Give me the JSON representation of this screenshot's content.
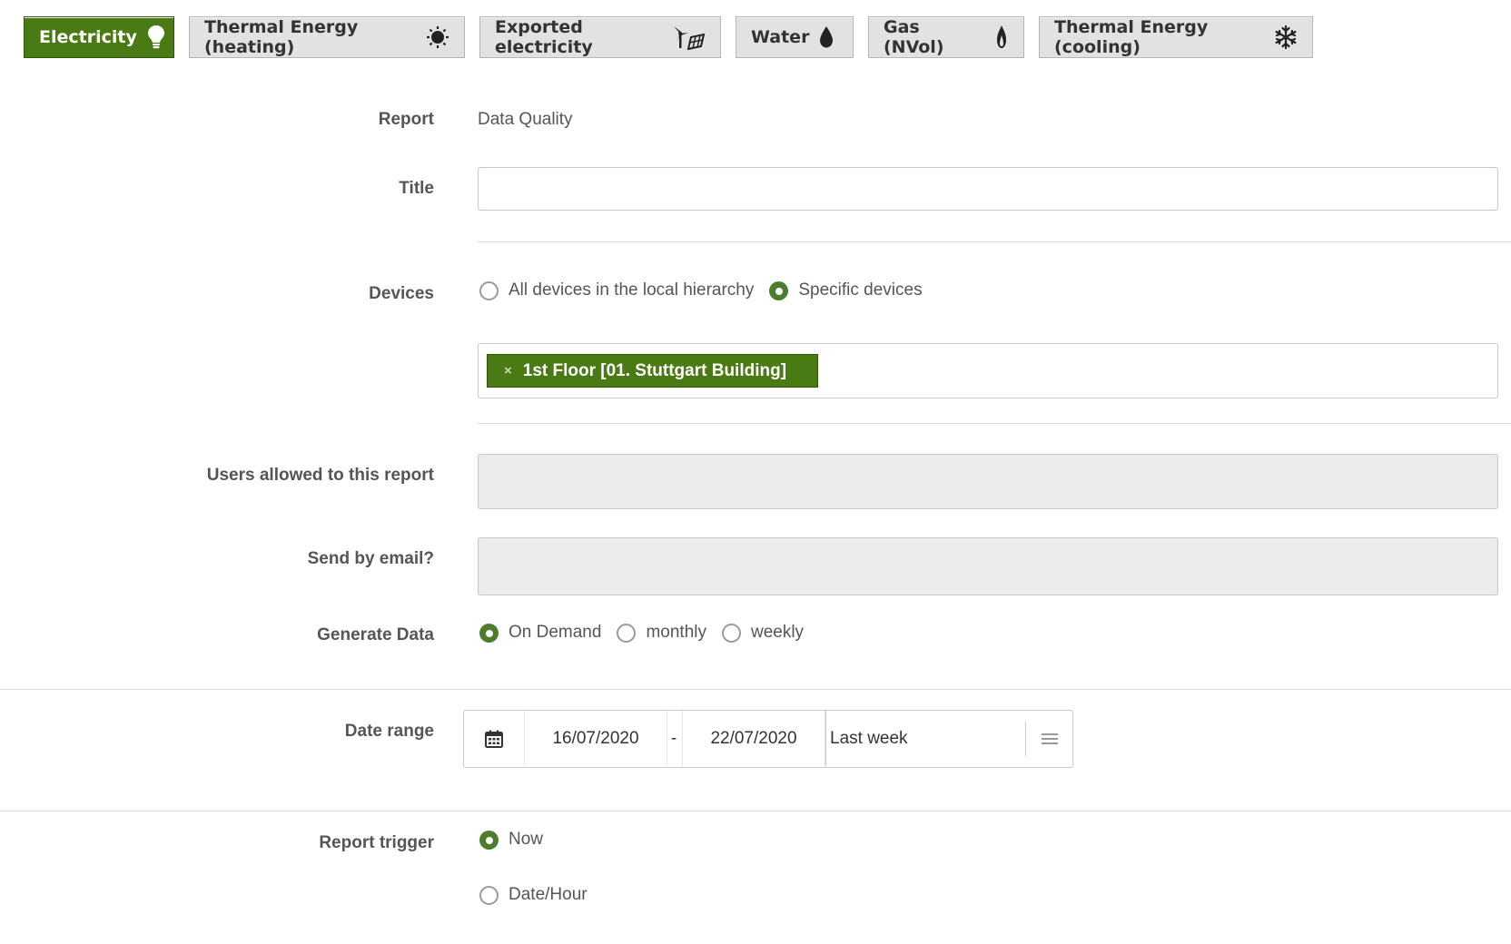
{
  "tabs": [
    {
      "label": "Electricity",
      "icon": "lightbulb-icon",
      "active": true
    },
    {
      "label": "Thermal Energy (heating)",
      "icon": "sun-icon",
      "active": false
    },
    {
      "label": "Exported electricity",
      "icon": "wind-solar-icon",
      "active": false
    },
    {
      "label": "Water",
      "icon": "water-drop-icon",
      "active": false
    },
    {
      "label": "Gas (NVol)",
      "icon": "flame-icon",
      "active": false
    },
    {
      "label": "Thermal Energy (cooling)",
      "icon": "snowflake-icon",
      "active": false
    }
  ],
  "form": {
    "report": {
      "label": "Report",
      "value": "Data Quality"
    },
    "title": {
      "label": "Title",
      "value": ""
    },
    "devices": {
      "label": "Devices",
      "options": [
        "All devices in the local hierarchy",
        "Specific devices"
      ],
      "selected": "Specific devices",
      "chips": [
        {
          "label": "1st Floor [01. Stuttgart Building]",
          "remove": "×"
        }
      ]
    },
    "users": {
      "label": "Users allowed to this report"
    },
    "email": {
      "label": "Send by email?"
    },
    "generate": {
      "label": "Generate Data",
      "options": [
        "On Demand",
        "monthly",
        "weekly"
      ],
      "selected": "On Demand"
    },
    "date_range": {
      "label": "Date range",
      "start": "16/07/2020",
      "separator": "-",
      "end": "22/07/2020",
      "preset": "Last week"
    },
    "trigger": {
      "label": "Report trigger",
      "options": [
        "Now",
        "Date/Hour"
      ],
      "selected": "Now"
    }
  },
  "colors": {
    "accent": "#4a7a14",
    "radio": "#4c7d2c"
  }
}
